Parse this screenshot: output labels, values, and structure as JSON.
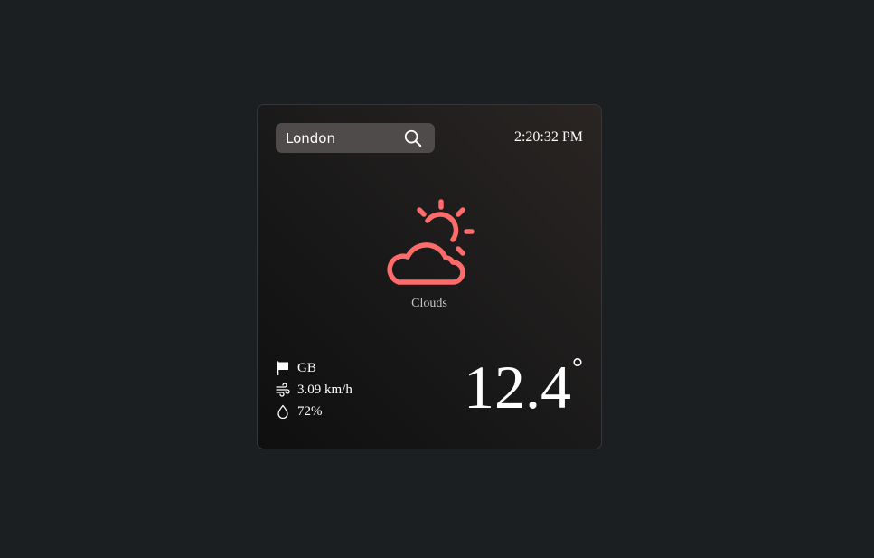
{
  "search": {
    "value": "London",
    "icon": "search-icon"
  },
  "clock": {
    "time": "2:20:32 PM"
  },
  "weather": {
    "icon": "partly-cloudy-icon",
    "icon_color": "#ff6b6b",
    "condition": "Clouds",
    "temperature": "12.4",
    "unit": "°"
  },
  "details": {
    "country": "GB",
    "country_icon": "flag-icon",
    "wind": "3.09 km/h",
    "wind_icon": "wind-icon",
    "humidity": "72%",
    "humidity_icon": "droplet-icon"
  }
}
